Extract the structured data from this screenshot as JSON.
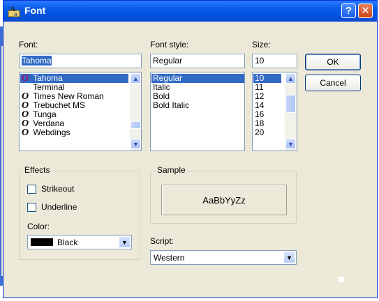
{
  "window": {
    "title": "Font"
  },
  "font": {
    "label": "Font:",
    "value": "Tahoma",
    "items": [
      {
        "icon": "O",
        "name": "Tahoma"
      },
      {
        "icon": "",
        "name": "Terminal"
      },
      {
        "icon": "O",
        "name": "Times New Roman"
      },
      {
        "icon": "O",
        "name": "Trebuchet MS"
      },
      {
        "icon": "O",
        "name": "Tunga"
      },
      {
        "icon": "O",
        "name": "Verdana"
      },
      {
        "icon": "O",
        "name": "Webdings"
      }
    ]
  },
  "style": {
    "label": "Font style:",
    "value": "Regular",
    "items": [
      "Regular",
      "Italic",
      "Bold",
      "Bold Italic"
    ]
  },
  "size": {
    "label": "Size:",
    "value": "10",
    "items": [
      "10",
      "11",
      "12",
      "14",
      "16",
      "18",
      "20"
    ]
  },
  "buttons": {
    "ok": "OK",
    "cancel": "Cancel"
  },
  "effects": {
    "label": "Effects",
    "strikeout": "Strikeout",
    "underline": "Underline",
    "color_label": "Color:",
    "color_value": "Black"
  },
  "sample": {
    "label": "Sample",
    "text": "AaBbYyZz"
  },
  "script": {
    "label": "Script:",
    "value": "Western"
  }
}
